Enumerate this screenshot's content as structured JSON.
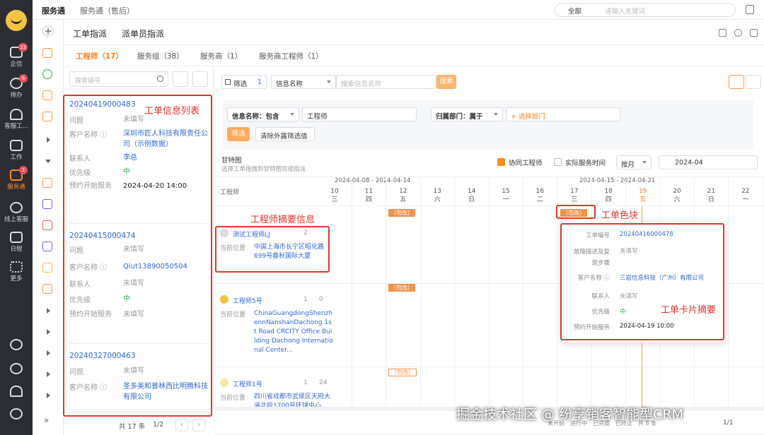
{
  "colors": {
    "accent": "#ff7d1a",
    "link": "#2b6ad8",
    "annotation": "#e0352b",
    "priority": "#2fae4f",
    "rail": "#2b2d33"
  },
  "rail": {
    "items": [
      {
        "label": "企信",
        "icon": "chat-icon",
        "badge": "23"
      },
      {
        "label": "待办",
        "icon": "check-circle-icon",
        "badge": "6"
      },
      {
        "label": "客服工...",
        "icon": "headset-icon",
        "badge": ""
      },
      {
        "label": "工作",
        "icon": "briefcase-icon",
        "badge": ""
      },
      {
        "label": "服务通",
        "icon": "service-icon",
        "badge": "2"
      },
      {
        "label": "线上客服",
        "icon": "message-icon",
        "badge": ""
      },
      {
        "label": "日程",
        "icon": "calendar-icon",
        "badge": ""
      },
      {
        "label": "更多",
        "icon": "grid-icon",
        "badge": ""
      }
    ]
  },
  "topbar": {
    "app_name": "服务通",
    "service_select": "服务通（售后）",
    "search_scope": "全部",
    "search_placeholder": "请输入关键词"
  },
  "header": {
    "title1": "工单指派",
    "title2": "派单员指派"
  },
  "tabs": [
    "工程师（17）",
    "服务组（38）",
    "服务商（1）",
    "服务商工程师（1）"
  ],
  "list": {
    "search_placeholder": "搜索编号",
    "cards": [
      {
        "number": "20240419000483",
        "fields": [
          {
            "k": "问题",
            "v": "未填写",
            "style": ""
          },
          {
            "k": "客户名称 ⓘ",
            "v": "深圳市匠人科技有限责任公司（示例数据）",
            "style": "link"
          },
          {
            "k": "联系人",
            "v": "李总",
            "style": "link"
          },
          {
            "k": "优先级",
            "v": "中",
            "style": "green"
          },
          {
            "k": "预约开始服务",
            "v": "2024-04-20 14:00",
            "style": "dark"
          }
        ]
      },
      {
        "number": "20240415000474",
        "fields": [
          {
            "k": "问题",
            "v": "未填写",
            "style": ""
          },
          {
            "k": "客户名称 ⓘ",
            "v": "Qiut13890050504",
            "style": "link"
          },
          {
            "k": "联系人",
            "v": "未填写",
            "style": ""
          },
          {
            "k": "优先级",
            "v": "中",
            "style": "green"
          },
          {
            "k": "预约开始服务",
            "v": "未填写",
            "style": ""
          }
        ]
      },
      {
        "number": "20240327000463",
        "fields": [
          {
            "k": "问题",
            "v": "未填写",
            "style": ""
          },
          {
            "k": "客户名称 ⓘ",
            "v": "圣多美和普林西比明腾科技有限公司",
            "style": "link"
          }
        ]
      }
    ],
    "total": "共 17 条",
    "page": "1/2"
  },
  "annotations": {
    "list": "工单信息列表",
    "engineer": "工程师摘要信息",
    "block": "工单色块",
    "card": "工单卡片摘要"
  },
  "gantt": {
    "filter_label": "筛选",
    "filter_count": "1",
    "info_select": "信息名称",
    "info_placeholder": "搜索信息名称",
    "search_btn": "搜索",
    "cond_field": "信息名称：包含",
    "cond_value": "工程师",
    "dept_label": "归属部门：属于",
    "dept_placeholder": "+ 选择部门",
    "apply_btn": "筛选",
    "clear_btn": "清除外露筛选值",
    "section_title": "甘特图",
    "section_sub": "选择工单拖拽到甘特图完成指派",
    "opt_cowork": "协同工程师",
    "opt_actual": "实际服务时间",
    "period": "按月",
    "month": "2024-04",
    "col_engineer": "工程师",
    "week1": "2024-04-08 - 2024-04-14",
    "week2": "2024-04-15 - 2024-04-21",
    "days": [
      {
        "d": "10",
        "w": "三"
      },
      {
        "d": "11",
        "w": "四"
      },
      {
        "d": "12",
        "w": "五"
      },
      {
        "d": "13",
        "w": "六"
      },
      {
        "d": "14",
        "w": "日"
      },
      {
        "d": "15",
        "w": "一"
      },
      {
        "d": "16",
        "w": "二"
      },
      {
        "d": "17",
        "w": "三"
      },
      {
        "d": "18",
        "w": "四"
      },
      {
        "d": "19",
        "w": "五"
      },
      {
        "d": "20",
        "w": "六"
      },
      {
        "d": "21",
        "w": "日"
      },
      {
        "d": "22",
        "w": "一"
      }
    ],
    "engineers": [
      {
        "name": "测试工程师LJ",
        "c1": "2",
        "loc_label": "当前位置",
        "loc": "中国上海市长宁区昭化路699号春秋国际大厦"
      },
      {
        "name": "工程师5号",
        "c1": "1",
        "c2": "0",
        "loc_label": "当前位置",
        "loc": "ChinaGuangdongShenzhennNanshanDachong 1st Road CRCITY Office Building Dachong International Center..."
      },
      {
        "name": "工程师1号",
        "c1": "1",
        "c2": "24",
        "loc_label": "当前位置",
        "loc": "四川省成都市武侯区天府大道北段1700号环球中心..."
      }
    ],
    "tag_text": "（勿改）",
    "popup": [
      {
        "k": "工单编号",
        "v": "20240416000478",
        "style": "link"
      },
      {
        "k": "故障描述及复现步骤",
        "v": "未填写",
        "style": ""
      },
      {
        "k": "客户名称 ⓘ",
        "v": "三岩信息科技（广州）有限公司",
        "style": "link"
      },
      {
        "k": "联系人",
        "v": "未填写",
        "style": ""
      },
      {
        "k": "优先级",
        "v": "中",
        "style": "green"
      },
      {
        "k": "预约开始服务",
        "v": "2024-04-19 10:00",
        "style": "dark"
      }
    ],
    "legend": [
      "未开始",
      "进行中",
      "已完成",
      "已终止",
      "共 8 条"
    ],
    "pager": "1/1"
  },
  "watermark": "掘金技术社区 @ 纷享销客智能型CRM"
}
